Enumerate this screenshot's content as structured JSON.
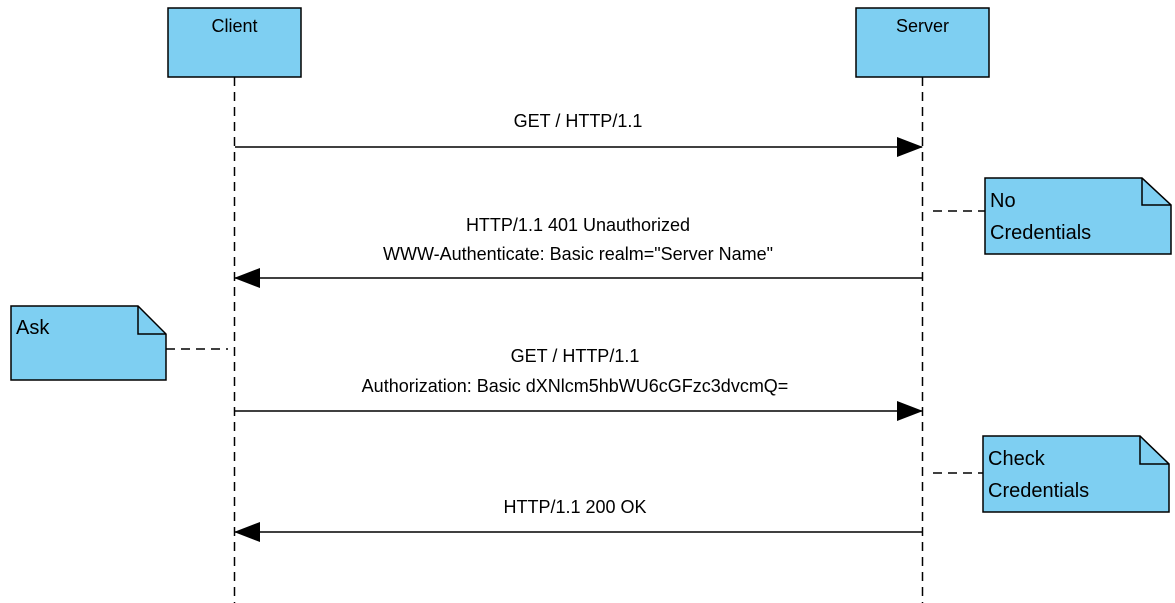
{
  "colors": {
    "fill": "#7ECFF2",
    "stroke": "#000000",
    "background": "#FFFFFF"
  },
  "participants": {
    "client": "Client",
    "server": "Server"
  },
  "messages": [
    {
      "from": "client",
      "to": "server",
      "lines": [
        "GET / HTTP/1.1"
      ]
    },
    {
      "from": "server",
      "to": "client",
      "lines": [
        "HTTP/1.1 401 Unauthorized",
        "WWW-Authenticate: Basic realm=\"Server Name\""
      ]
    },
    {
      "from": "client",
      "to": "server",
      "lines": [
        "GET / HTTP/1.1",
        "Authorization: Basic dXNlcm5hbWU6cGFzc3dvcmQ="
      ]
    },
    {
      "from": "server",
      "to": "client",
      "lines": [
        "HTTP/1.1 200 OK"
      ]
    }
  ],
  "notes": {
    "no_credentials": [
      "No",
      "Credentials"
    ],
    "ask": [
      "Ask"
    ],
    "check_credentials": [
      "Check",
      "Credentials"
    ]
  }
}
